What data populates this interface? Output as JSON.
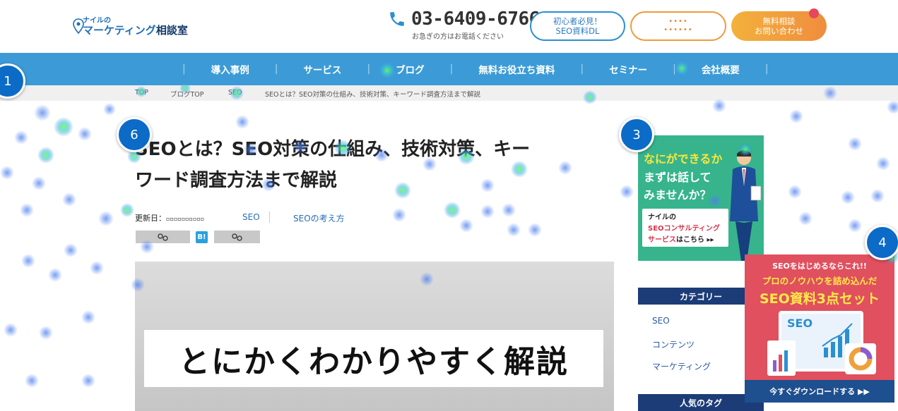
{
  "header": {
    "logo_small": "ナイルの",
    "logo_main": "マーケティング",
    "logo_main_suffix": "相談室",
    "phone_number": "03-6409-6766",
    "phone_note": "お急ぎの方はお電話ください",
    "btn_beginner_line1": "初心者必見！",
    "btn_beginner_line2": "SEO資料DL",
    "btn_mid_line1": "••••",
    "btn_mid_line2": "••••••",
    "btn_contact_line1": "無料相談",
    "btn_contact_line2": "お問い合わせ"
  },
  "nav": {
    "items": [
      "導入事例",
      "サービス",
      "ブログ",
      "無料お役立ち資料",
      "セミナー",
      "会社概要"
    ]
  },
  "breadcrumb": {
    "items": [
      "TOP",
      "ブログTOP",
      "SEO",
      "SEOとは？SEO対策の仕組み、技術対策、キーワード調査方法まで解説"
    ]
  },
  "article": {
    "title_line1": "SEOとは？SEO対策の仕組み、技術対策、キー",
    "title_line2": "ワード調査方法まで解説",
    "updated_label": "更新日：",
    "updated_value": "▫▫▫▫▫▫▫▫▫▫",
    "tag_seo": "SEO",
    "tag_think": "SEOの考え方",
    "share_b": "B!",
    "hero_text": "とにかくわかりやすく解説"
  },
  "sidebar": {
    "banner_line1": "なにができるか",
    "banner_line2": "まずは話して",
    "banner_line3": "みませんか？",
    "card_line1": "ナイルの",
    "card_line2": "SEOコンサルティング",
    "card_line3a": "サービス",
    "card_line3b": "はこちら ▸▸",
    "category_heading": "カテゴリー",
    "categories": [
      "SEO",
      "コンテンツ",
      "マーケティング"
    ],
    "tags_heading": "人気のタグ"
  },
  "popup": {
    "line1": "SEOをはじめるならこれ!!",
    "line2": "プロのノウハウを詰め込んだ",
    "line3": "SEO資料3点セット",
    "screen_label": "SEO",
    "footer": "今すぐダウンロードする ▶▶"
  },
  "markers": [
    "1",
    "6",
    "3",
    "4"
  ],
  "colors": {
    "nav_bg": "#3c9bd6",
    "brand_blue": "#1e6fb8",
    "sidebar_green": "#37b48c",
    "popup_red": "#e0505e",
    "marker_blue": "#0b6bc7"
  }
}
